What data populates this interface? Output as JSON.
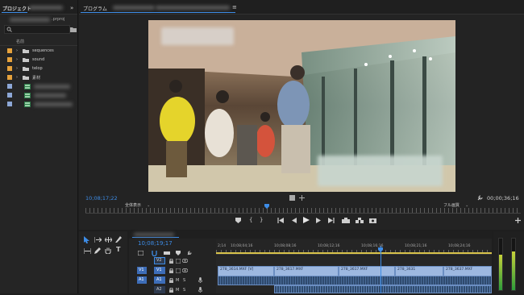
{
  "project": {
    "tab": "プロジェクト",
    "file_ext": ".prproj",
    "name_header": "名前",
    "items": [
      {
        "label": "sequences",
        "color": "#e6a23c"
      },
      {
        "label": "sound",
        "color": "#e6a23c"
      },
      {
        "label": "telop",
        "color": "#e6a23c"
      },
      {
        "label": "素材",
        "color": "#e6a23c"
      }
    ],
    "expand_icon": "double-chevron-right-icon"
  },
  "program": {
    "tab": "プログラム",
    "timecode_current": "10;08;17;22",
    "zoom_select": "全体表示",
    "quality_select": "フル画質",
    "duration": "00;00;36;16",
    "playhead_icon": "playhead-marker-icon"
  },
  "timeline": {
    "timecode": "10;08;19;17",
    "ruler_start": "2;14",
    "ruler_labels": [
      "10;08;04;16",
      "10;08;08;16",
      "10;08;12;16",
      "10;08;16;16",
      "10;08;21;16",
      "10;08;24;16",
      "10;08;28;16",
      "10;08;32;16"
    ],
    "tracks": [
      {
        "label": "V2"
      },
      {
        "src": "V1",
        "label": "V1"
      },
      {
        "src": "A1",
        "label": "A1"
      },
      {
        "label": "A2"
      }
    ],
    "clips_v1": [
      "278_3614.MXF [V]",
      "278_3617.MXF",
      "278_3617.MXF",
      "278_3631",
      "278_3637.MXF"
    ]
  },
  "icons": {
    "selection": "selection-tool-icon",
    "track_select": "track-select-forward-icon",
    "ripple": "ripple-edit-icon",
    "razor": "razor-icon",
    "slip": "slip-tool-icon",
    "pen": "pen-icon",
    "hand": "hand-icon",
    "type": "type-tool-icon",
    "wrench": "wrench-icon",
    "add": "plus-icon",
    "marker": "add-marker-icon",
    "in": "mark-in-icon",
    "out": "mark-out-icon",
    "go_in": "go-to-in-icon",
    "step_back": "step-back-icon",
    "play": "play-icon",
    "step_fwd": "step-forward-icon",
    "go_out": "go-to-out-icon",
    "lift": "lift-icon",
    "extract": "extract-icon",
    "export_frame": "camera-icon"
  },
  "colors": {
    "accent": "#3d8ce6",
    "folder": "#e6a23c",
    "clip": "#9db8e0",
    "audio": "#2f4a6e"
  }
}
